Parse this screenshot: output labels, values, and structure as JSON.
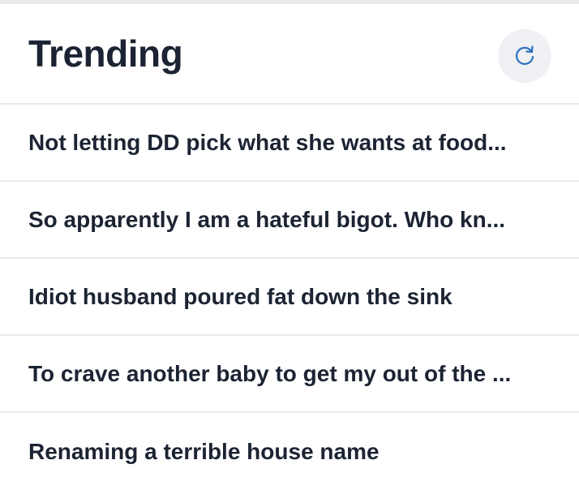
{
  "header": {
    "title": "Trending",
    "refresh_icon": "refresh-icon",
    "accent": "#2d6fc0"
  },
  "threads": [
    {
      "title": "Not letting DD pick what she wants at food..."
    },
    {
      "title": "So apparently I am a hateful bigot. Who kn..."
    },
    {
      "title": "Idiot husband poured fat down the sink"
    },
    {
      "title": "To crave another baby to get my out of the ..."
    },
    {
      "title": "Renaming a terrible house name"
    }
  ]
}
